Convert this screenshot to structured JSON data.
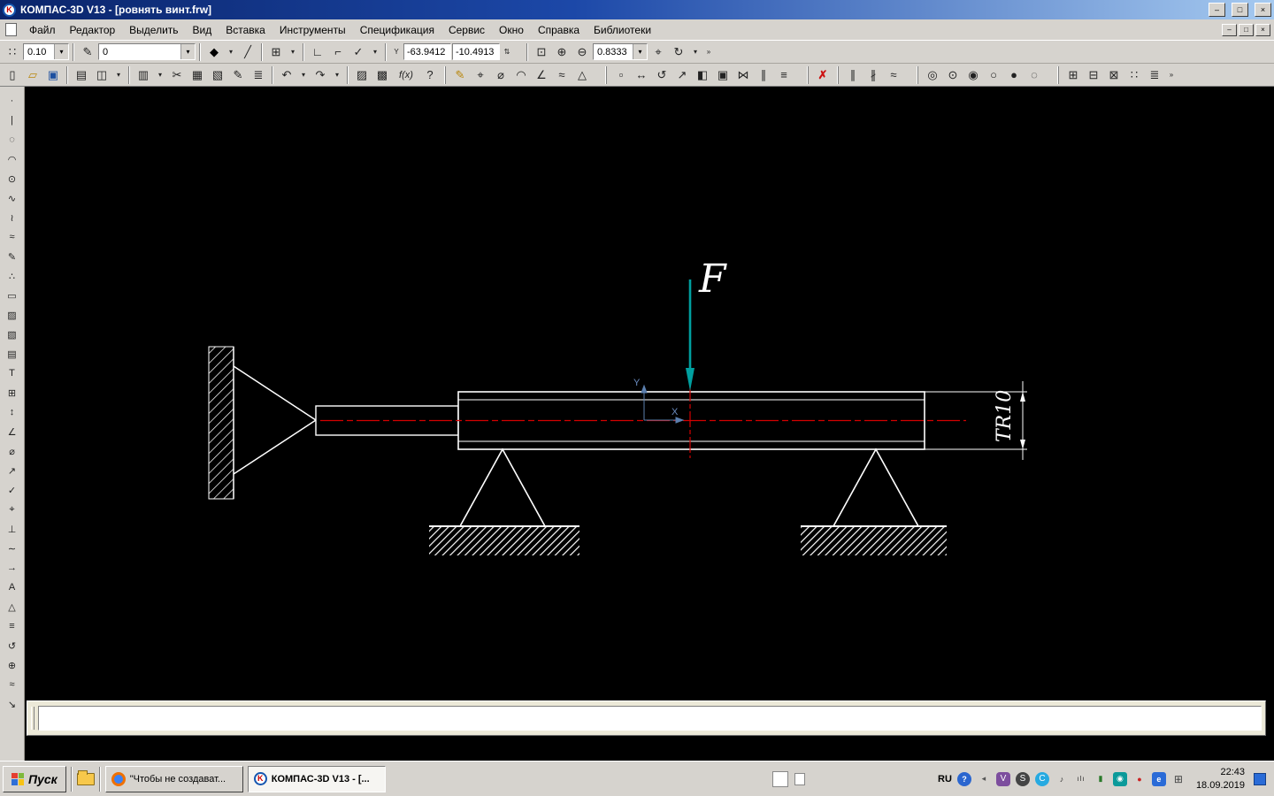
{
  "window": {
    "title": "КОМПАС-3D V13 - [ровнять винт.frw]"
  },
  "g": {
    "minimize": "–",
    "restore": "□",
    "close": "×",
    "drop": "▾",
    "overflow": "»"
  },
  "menu": {
    "items": [
      "Файл",
      "Редактор",
      "Выделить",
      "Вид",
      "Вставка",
      "Инструменты",
      "Спецификация",
      "Сервис",
      "Окно",
      "Справка",
      "Библиотеки"
    ]
  },
  "fields": {
    "line_width": "0.10",
    "layer": "0",
    "x": "-63.9412",
    "y": "-10.4913",
    "zoom": "0.8333"
  },
  "t1": [
    "∷",
    "✎",
    "◆",
    "╱",
    "⊞",
    "∟",
    "⌐",
    "✓",
    "Y",
    "⇅",
    "⊡",
    "⊕",
    "⊖",
    "⌖",
    "↻",
    "»"
  ],
  "t2": [
    "▯",
    "▱",
    "▣",
    "▤",
    "◫",
    "▥",
    "✂",
    "▦",
    "▧",
    "✎",
    "≣",
    "↶",
    "↷",
    "▨",
    "▩",
    "f(x)",
    "?",
    "✎",
    "⌖",
    "⌀",
    "◠",
    "∠",
    "≈",
    "△",
    "▫",
    "↔",
    "↺",
    "↗",
    "◧",
    "▣",
    "⋈",
    "∥",
    "≡",
    "✗",
    "∥",
    "∦",
    "≈",
    "◎",
    "⊙",
    "◉",
    "○",
    "●",
    "◌",
    "⊞",
    "⊟",
    "⊠",
    "∷",
    "≣",
    "»"
  ],
  "lt": [
    "·",
    "|",
    "◌",
    "◠",
    "⊙",
    "∿",
    "≀",
    "≈",
    "✎",
    "∴",
    "▭",
    "▨",
    "▧",
    "▤",
    "T",
    "⊞",
    "↕",
    "∠",
    "⌀",
    "↗",
    "✓",
    "⌖",
    "⊥",
    "∼",
    "→",
    "A",
    "△",
    "≡",
    "↺",
    "⊕",
    "≈",
    "↘"
  ],
  "drawing": {
    "force": "F",
    "dim": "TR10",
    "x": "X",
    "y": "Y"
  },
  "colors": {
    "force": "#009f9f",
    "centerline": "#d40000",
    "lines": "#ffffff",
    "background": "#000000"
  },
  "taskbar": {
    "start": "Пуск",
    "task1": "\"Чтобы не создават...",
    "task2": "КОМПАС-3D V13 - [..."
  },
  "tray": {
    "lang": "RU",
    "time": "22:43",
    "date": "18.09.2019",
    "items": [
      {
        "g": "?",
        "s": "background:#2b66cf;color:#fff;border-radius:50%;font-weight:bold"
      },
      {
        "g": "◂",
        "s": "color:#555"
      },
      {
        "g": "V",
        "s": "background:#7d4e9e;color:#fff;border-radius:4px;font-size:10px"
      },
      {
        "g": "S",
        "s": "background:#444;color:#fff;border-radius:50%;font-size:10px"
      },
      {
        "g": "C",
        "s": "background:#27aae1;color:#fff;border-radius:50%;font-size:10px"
      },
      {
        "g": "♪",
        "s": "color:#333"
      },
      {
        "g": "ılı",
        "s": "color:#333;font-size:8px;letter-spacing:1px"
      },
      {
        "g": "▮",
        "s": "color:#2a7a2a"
      },
      {
        "g": "◉",
        "s": "background:#0b9a9a;color:#fff;border-radius:3px"
      },
      {
        "g": "●",
        "s": "color:#cc2222"
      },
      {
        "g": "e",
        "s": "background:#2a6bd7;color:#fff;border-radius:3px;font-weight:bold"
      },
      {
        "g": "⊞",
        "s": "color:#444;font-size:12px"
      }
    ]
  }
}
